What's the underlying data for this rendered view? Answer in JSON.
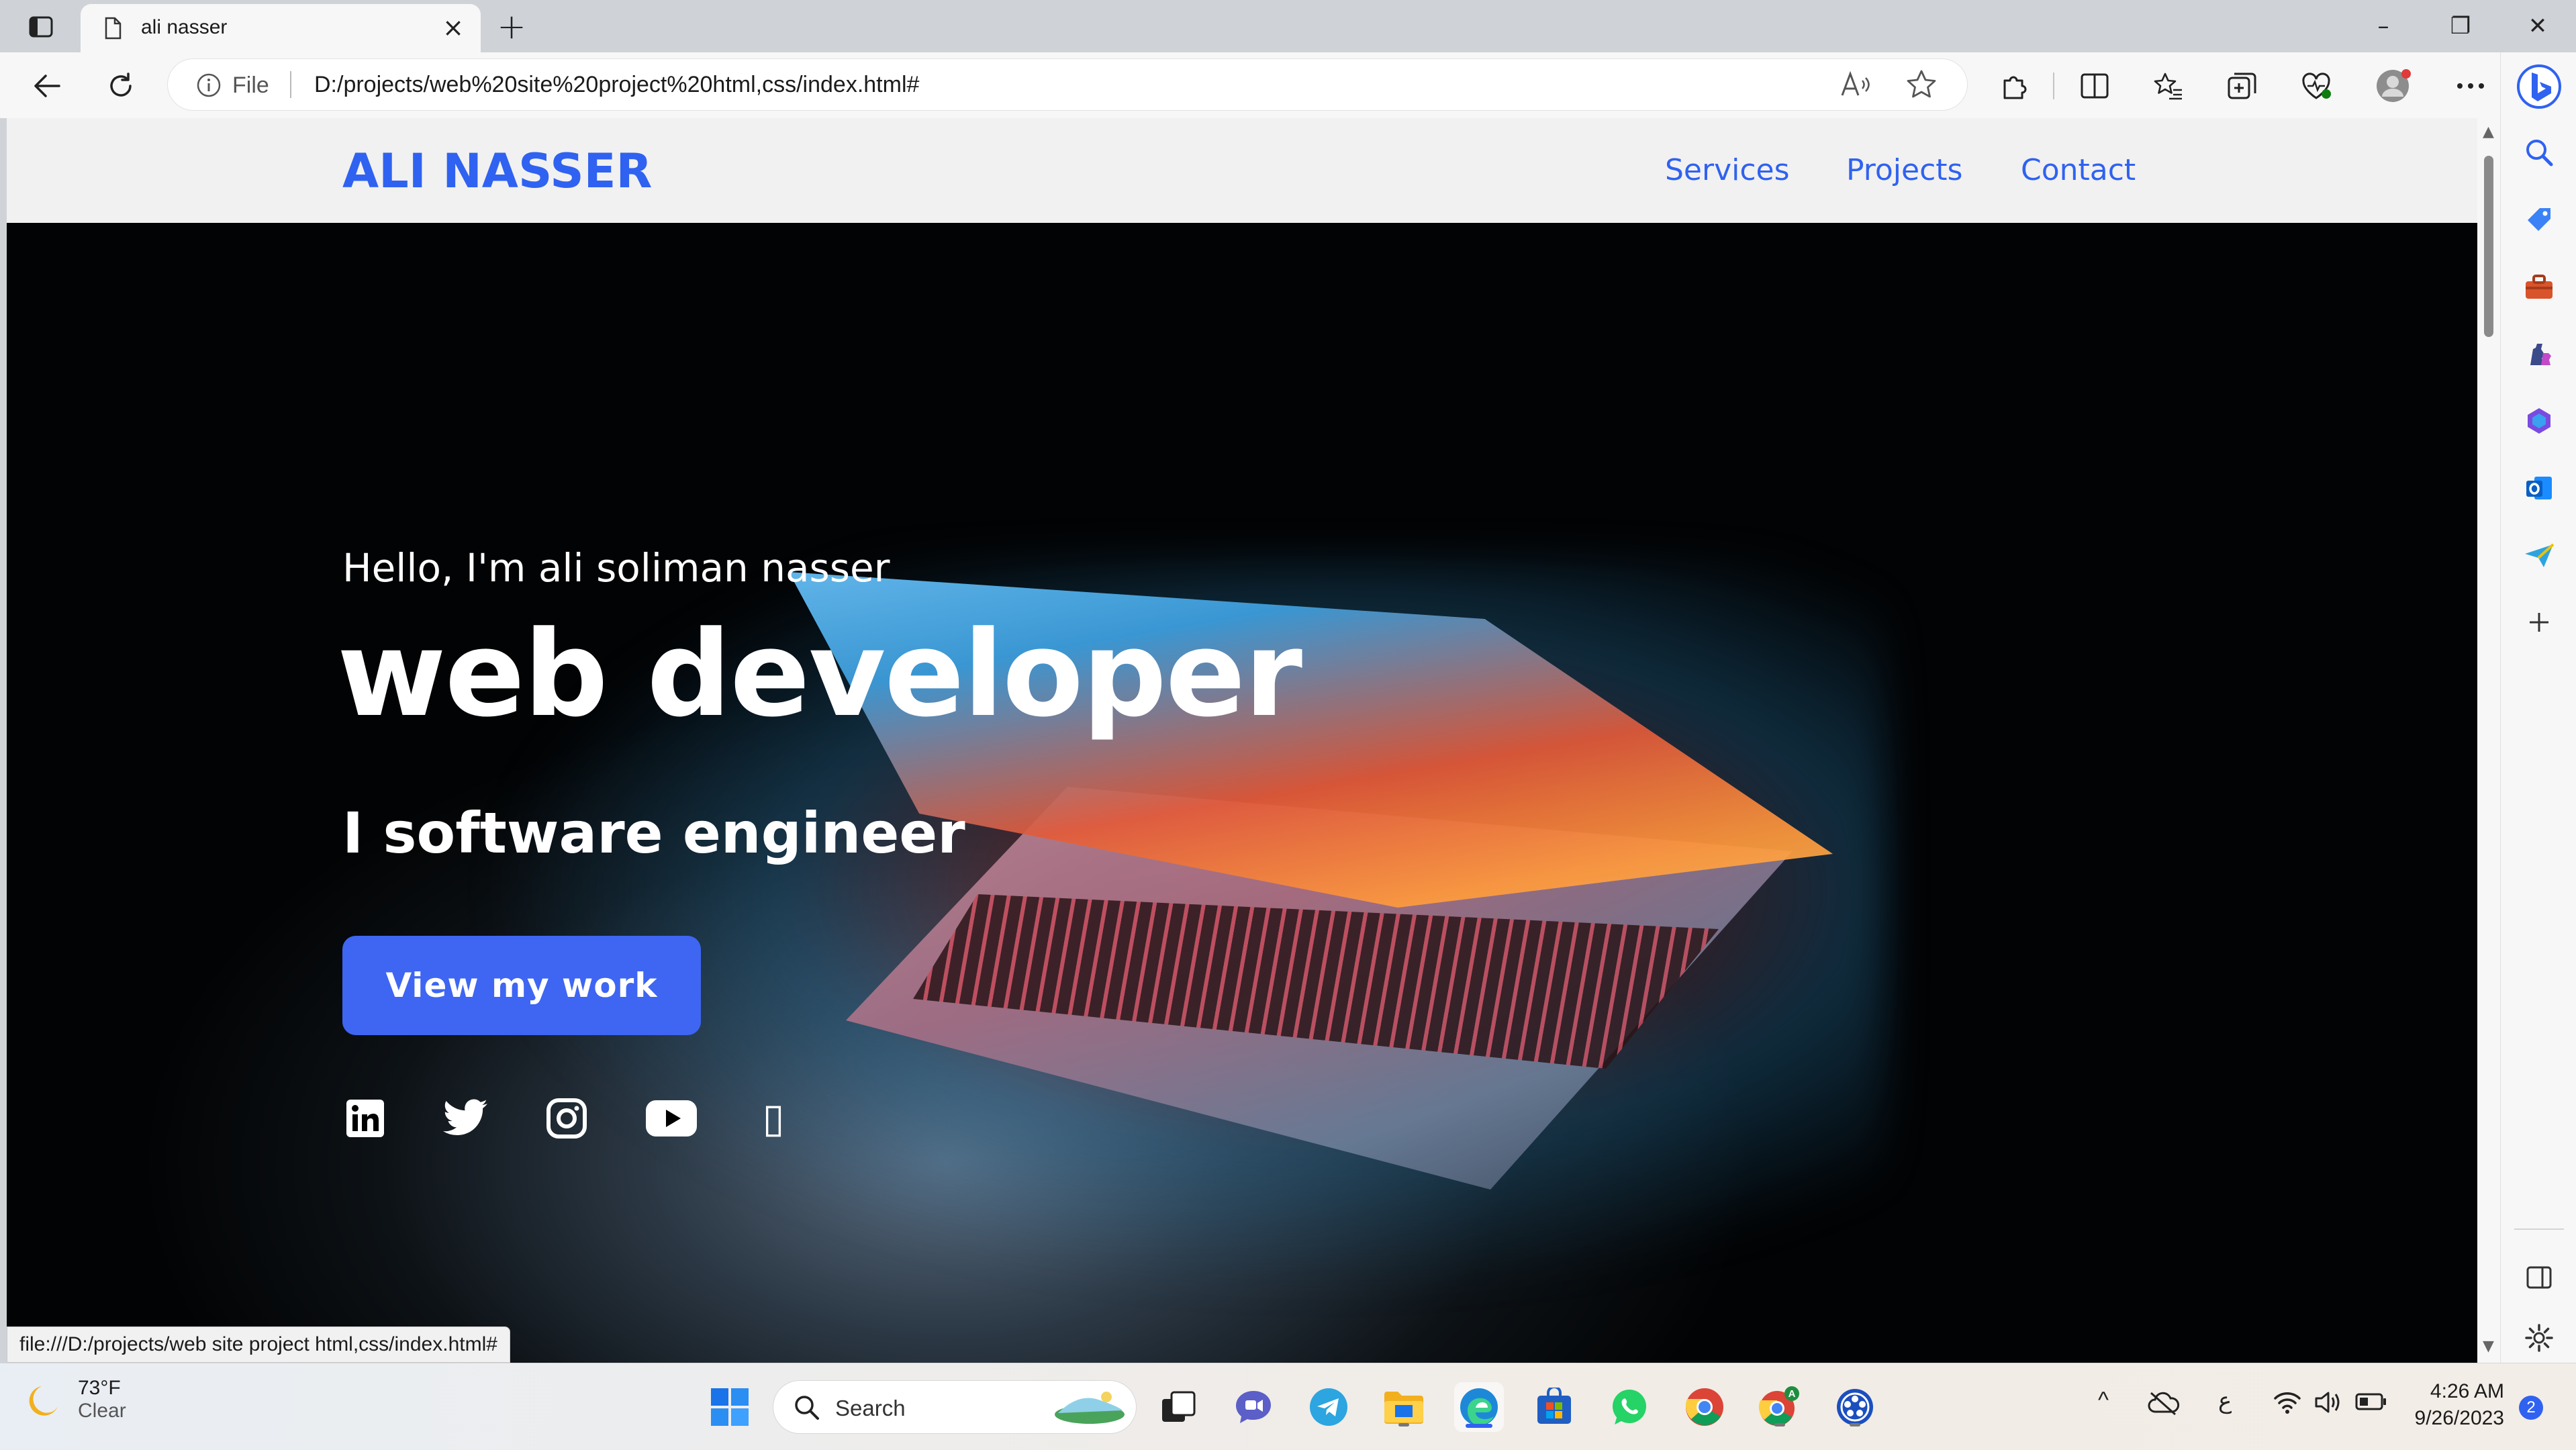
{
  "browser": {
    "tab": {
      "title": "ali nasser",
      "close": "×"
    },
    "new_tab": "+",
    "window_controls": {
      "minimize": "–",
      "restore": "❐",
      "close": "✕"
    },
    "address": {
      "site_info_label": "File",
      "url": "D:/projects/web%20site%20project%20html,css/index.html#",
      "read_aloud": "Aͅ))"
    },
    "status_url": "file:///D:/projects/web site project html,css/index.html#"
  },
  "page": {
    "logo": "ALI NASSER",
    "nav": [
      "Services",
      "Projects",
      "Contact"
    ],
    "greeting": "Hello, I'm ali soliman nasser",
    "headline": "web developer",
    "subhead": "I software engineer",
    "cta": "View my work",
    "socials": [
      "linkedin-icon",
      "twitter-icon",
      "instagram-icon",
      "youtube-icon",
      "missing-glyph-icon"
    ],
    "missing_glyph": "▯"
  },
  "sidebar_icons": [
    "bing-copilot-icon",
    "search-icon",
    "shopping-tag-icon",
    "toolbox-icon",
    "games-icon",
    "office-icon",
    "outlook-icon",
    "send-icon",
    "add-icon",
    "split-panel-icon",
    "settings-icon"
  ],
  "taskbar": {
    "weather": {
      "temp": "73°F",
      "condition": "Clear"
    },
    "search_label": "Search",
    "tray": {
      "chevron": "^",
      "lang": "ع"
    },
    "clock": {
      "time": "4:26 AM",
      "date": "9/26/2023"
    },
    "notifications": "2"
  },
  "colors": {
    "brand_blue": "#2f62f0",
    "cta_blue": "#3e66f2",
    "header_bg": "#f1f1f1"
  }
}
